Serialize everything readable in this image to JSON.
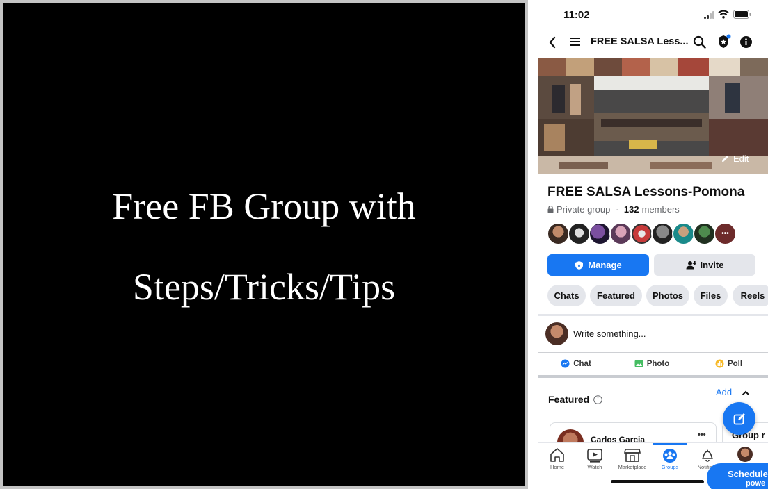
{
  "banner": {
    "line1": "Free FB Group with",
    "line2": "Steps/Tricks/Tips"
  },
  "status_bar": {
    "time": "11:02"
  },
  "nav": {
    "title": "FREE SALSA Less...",
    "icons": [
      "back-icon",
      "menu-icon",
      "search-icon",
      "shield-star-icon",
      "info-icon"
    ]
  },
  "cover": {
    "edit_label": "Edit"
  },
  "group": {
    "name": "FREE SALSA Lessons-Pomona",
    "privacy": "Private group",
    "separator": " · ",
    "member_count": "132",
    "members_word": "members"
  },
  "buttons": {
    "manage": "Manage",
    "invite": "Invite"
  },
  "chips": [
    "Chats",
    "Featured",
    "Photos",
    "Files",
    "Reels"
  ],
  "composer": {
    "placeholder": "Write something..."
  },
  "actions": {
    "chat": "Chat",
    "photo": "Photo",
    "poll": "Poll"
  },
  "featured": {
    "title": "Featured",
    "add_label": "Add",
    "post_author": "Carlos Garcia",
    "more_label": "•••",
    "side_card_title": "Group r"
  },
  "tabbar": {
    "items": [
      "Home",
      "Watch",
      "Marketplace",
      "Groups",
      "Notificati"
    ],
    "active": "Groups"
  },
  "schedule": {
    "label": "Schedule",
    "sub": "powe"
  },
  "colors": {
    "accent": "#1877f2",
    "chip_bg": "#e4e6eb",
    "banner_bg": "#000000",
    "banner_text": "#ffffff"
  }
}
